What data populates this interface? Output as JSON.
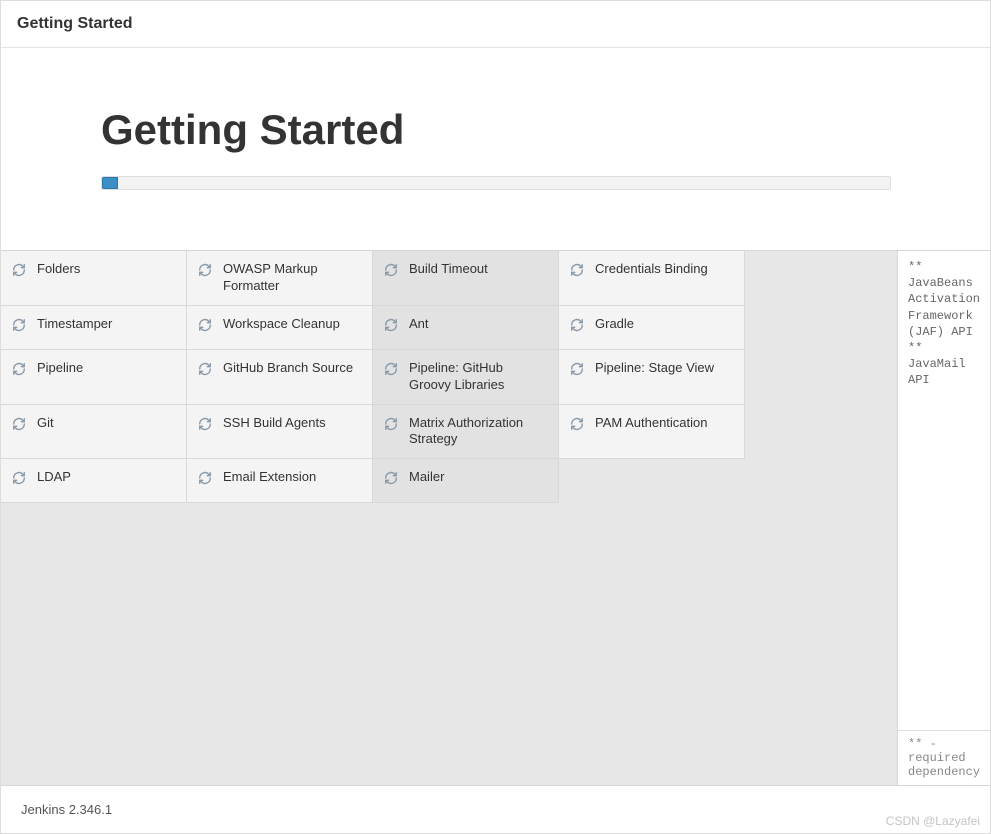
{
  "titlebar": "Getting Started",
  "heading": "Getting Started",
  "progress": {
    "percent": 2
  },
  "plugins": [
    {
      "name": "Folders",
      "status": "pending"
    },
    {
      "name": "OWASP Markup Formatter",
      "status": "pending"
    },
    {
      "name": "Build Timeout",
      "status": "active"
    },
    {
      "name": "Credentials Binding",
      "status": "pending"
    },
    {
      "name": "Timestamper",
      "status": "pending"
    },
    {
      "name": "Workspace Cleanup",
      "status": "pending"
    },
    {
      "name": "Ant",
      "status": "active"
    },
    {
      "name": "Gradle",
      "status": "pending"
    },
    {
      "name": "Pipeline",
      "status": "pending"
    },
    {
      "name": "GitHub Branch Source",
      "status": "pending"
    },
    {
      "name": "Pipeline: GitHub Groovy Libraries",
      "status": "active"
    },
    {
      "name": "Pipeline: Stage View",
      "status": "pending"
    },
    {
      "name": "Git",
      "status": "pending"
    },
    {
      "name": "SSH Build Agents",
      "status": "pending"
    },
    {
      "name": "Matrix Authorization Strategy",
      "status": "active"
    },
    {
      "name": "PAM Authentication",
      "status": "pending"
    },
    {
      "name": "LDAP",
      "status": "pending"
    },
    {
      "name": "Email Extension",
      "status": "pending"
    },
    {
      "name": "Mailer",
      "status": "active"
    }
  ],
  "log_lines": [
    "** JavaBeans Activation Framework (JAF) API",
    "** JavaMail API"
  ],
  "log_footnote": "** - required dependency",
  "footer_version": "Jenkins 2.346.1",
  "watermark": "CSDN @Lazyafei"
}
